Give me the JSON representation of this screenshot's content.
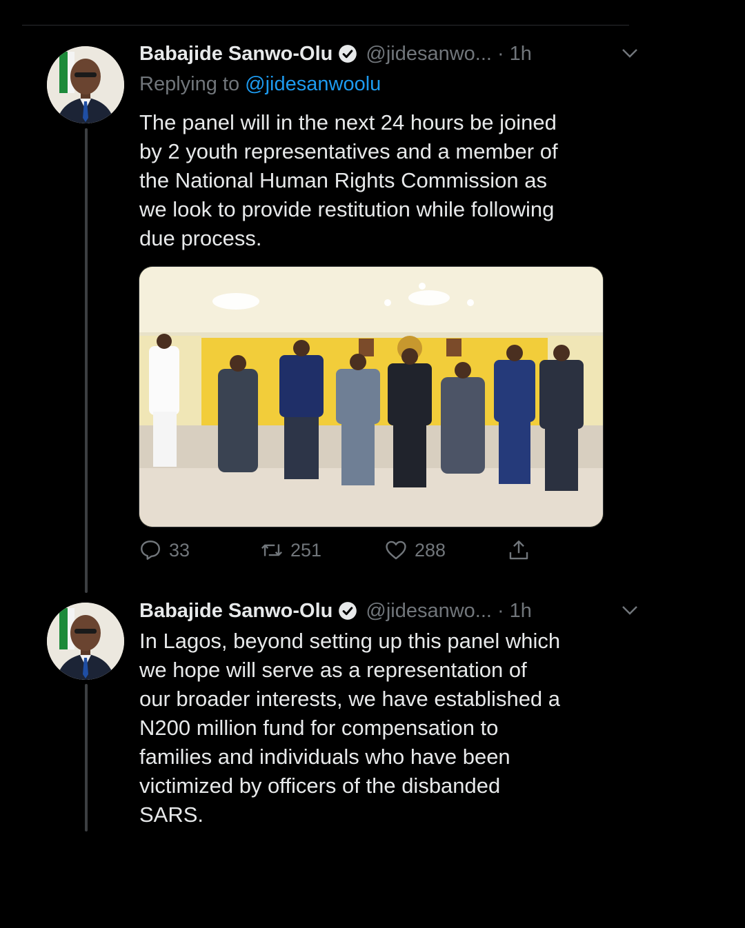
{
  "tweets": [
    {
      "name": "Babajide Sanwo-Olu",
      "handle": "@jidesanwo...",
      "dot": "·",
      "time": "1h",
      "reply_prefix": "Replying to ",
      "reply_handle": "@jidesanwoolu",
      "text": "The panel will in the next 24 hours be joined\nby 2 youth representatives and a member of\nthe National Human Rights Commission as\nwe look to provide restitution while following\ndue process.",
      "stats": {
        "replies": "33",
        "retweets": "251",
        "likes": "288"
      }
    },
    {
      "name": "Babajide Sanwo-Olu",
      "handle": "@jidesanwo...",
      "dot": "·",
      "time": "1h",
      "text": "In Lagos, beyond setting up this panel which\nwe hope will serve as a representation of\nour broader interests, we have established a\nN200 million fund for compensation to\nfamilies and individuals who have been\nvictimized by officers of the disbanded\nSARS."
    }
  ],
  "icons": {
    "verified": "verified-badge-icon",
    "more": "chevron-down-icon",
    "reply": "reply-icon",
    "retweet": "retweet-icon",
    "like": "heart-icon",
    "share": "share-icon"
  },
  "colors": {
    "background": "#000000",
    "text": "#e7e9ea",
    "muted": "#71767b",
    "link": "#1d9bf0"
  }
}
